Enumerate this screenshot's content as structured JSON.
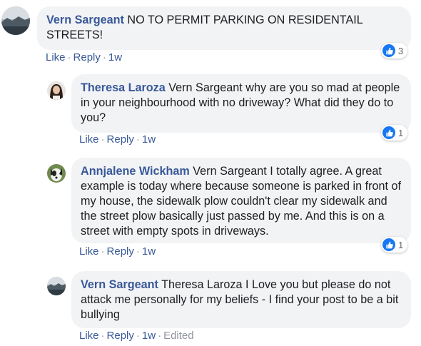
{
  "comments": [
    {
      "author": "Vern Sargeant",
      "text": "NO TO PERMIT PARKING ON RESIDENTAIL STREETS!",
      "actions": {
        "like": "Like",
        "reply": "Reply",
        "time": "1w"
      },
      "reaction_count": "3",
      "avatar": "landscape-photo-avatar"
    },
    {
      "author": "Theresa Laroza",
      "text": "Vern Sargeant why are you so mad at people in your neighbourhood with no driveway? What did they do to you?",
      "actions": {
        "like": "Like",
        "reply": "Reply",
        "time": "1w"
      },
      "reaction_count": "1",
      "avatar": "woman-portrait-avatar"
    },
    {
      "author": "Annjalene Wickham",
      "text": "Vern Sargeant I totally agree. A great example is today where because someone is parked in front of my house, the sidewalk plow couldn't clear my sidewalk and the street plow basically just passed by me. And this is on a street with empty spots in driveways.",
      "actions": {
        "like": "Like",
        "reply": "Reply",
        "time": "1w"
      },
      "reaction_count": "1",
      "avatar": "dog-photo-avatar"
    },
    {
      "author": "Vern Sargeant",
      "text": "Theresa Laroza I Love you but please do not attack me personally for my beliefs - I find your post to be a bit bullying",
      "actions": {
        "like": "Like",
        "reply": "Reply",
        "time": "1w",
        "edited": "Edited"
      },
      "avatar": "landscape-photo-avatar"
    }
  ],
  "colors": {
    "author": "#385898",
    "bubble": "#f2f3f5",
    "like_blue": "#1877f2",
    "meta": "#90949c"
  }
}
